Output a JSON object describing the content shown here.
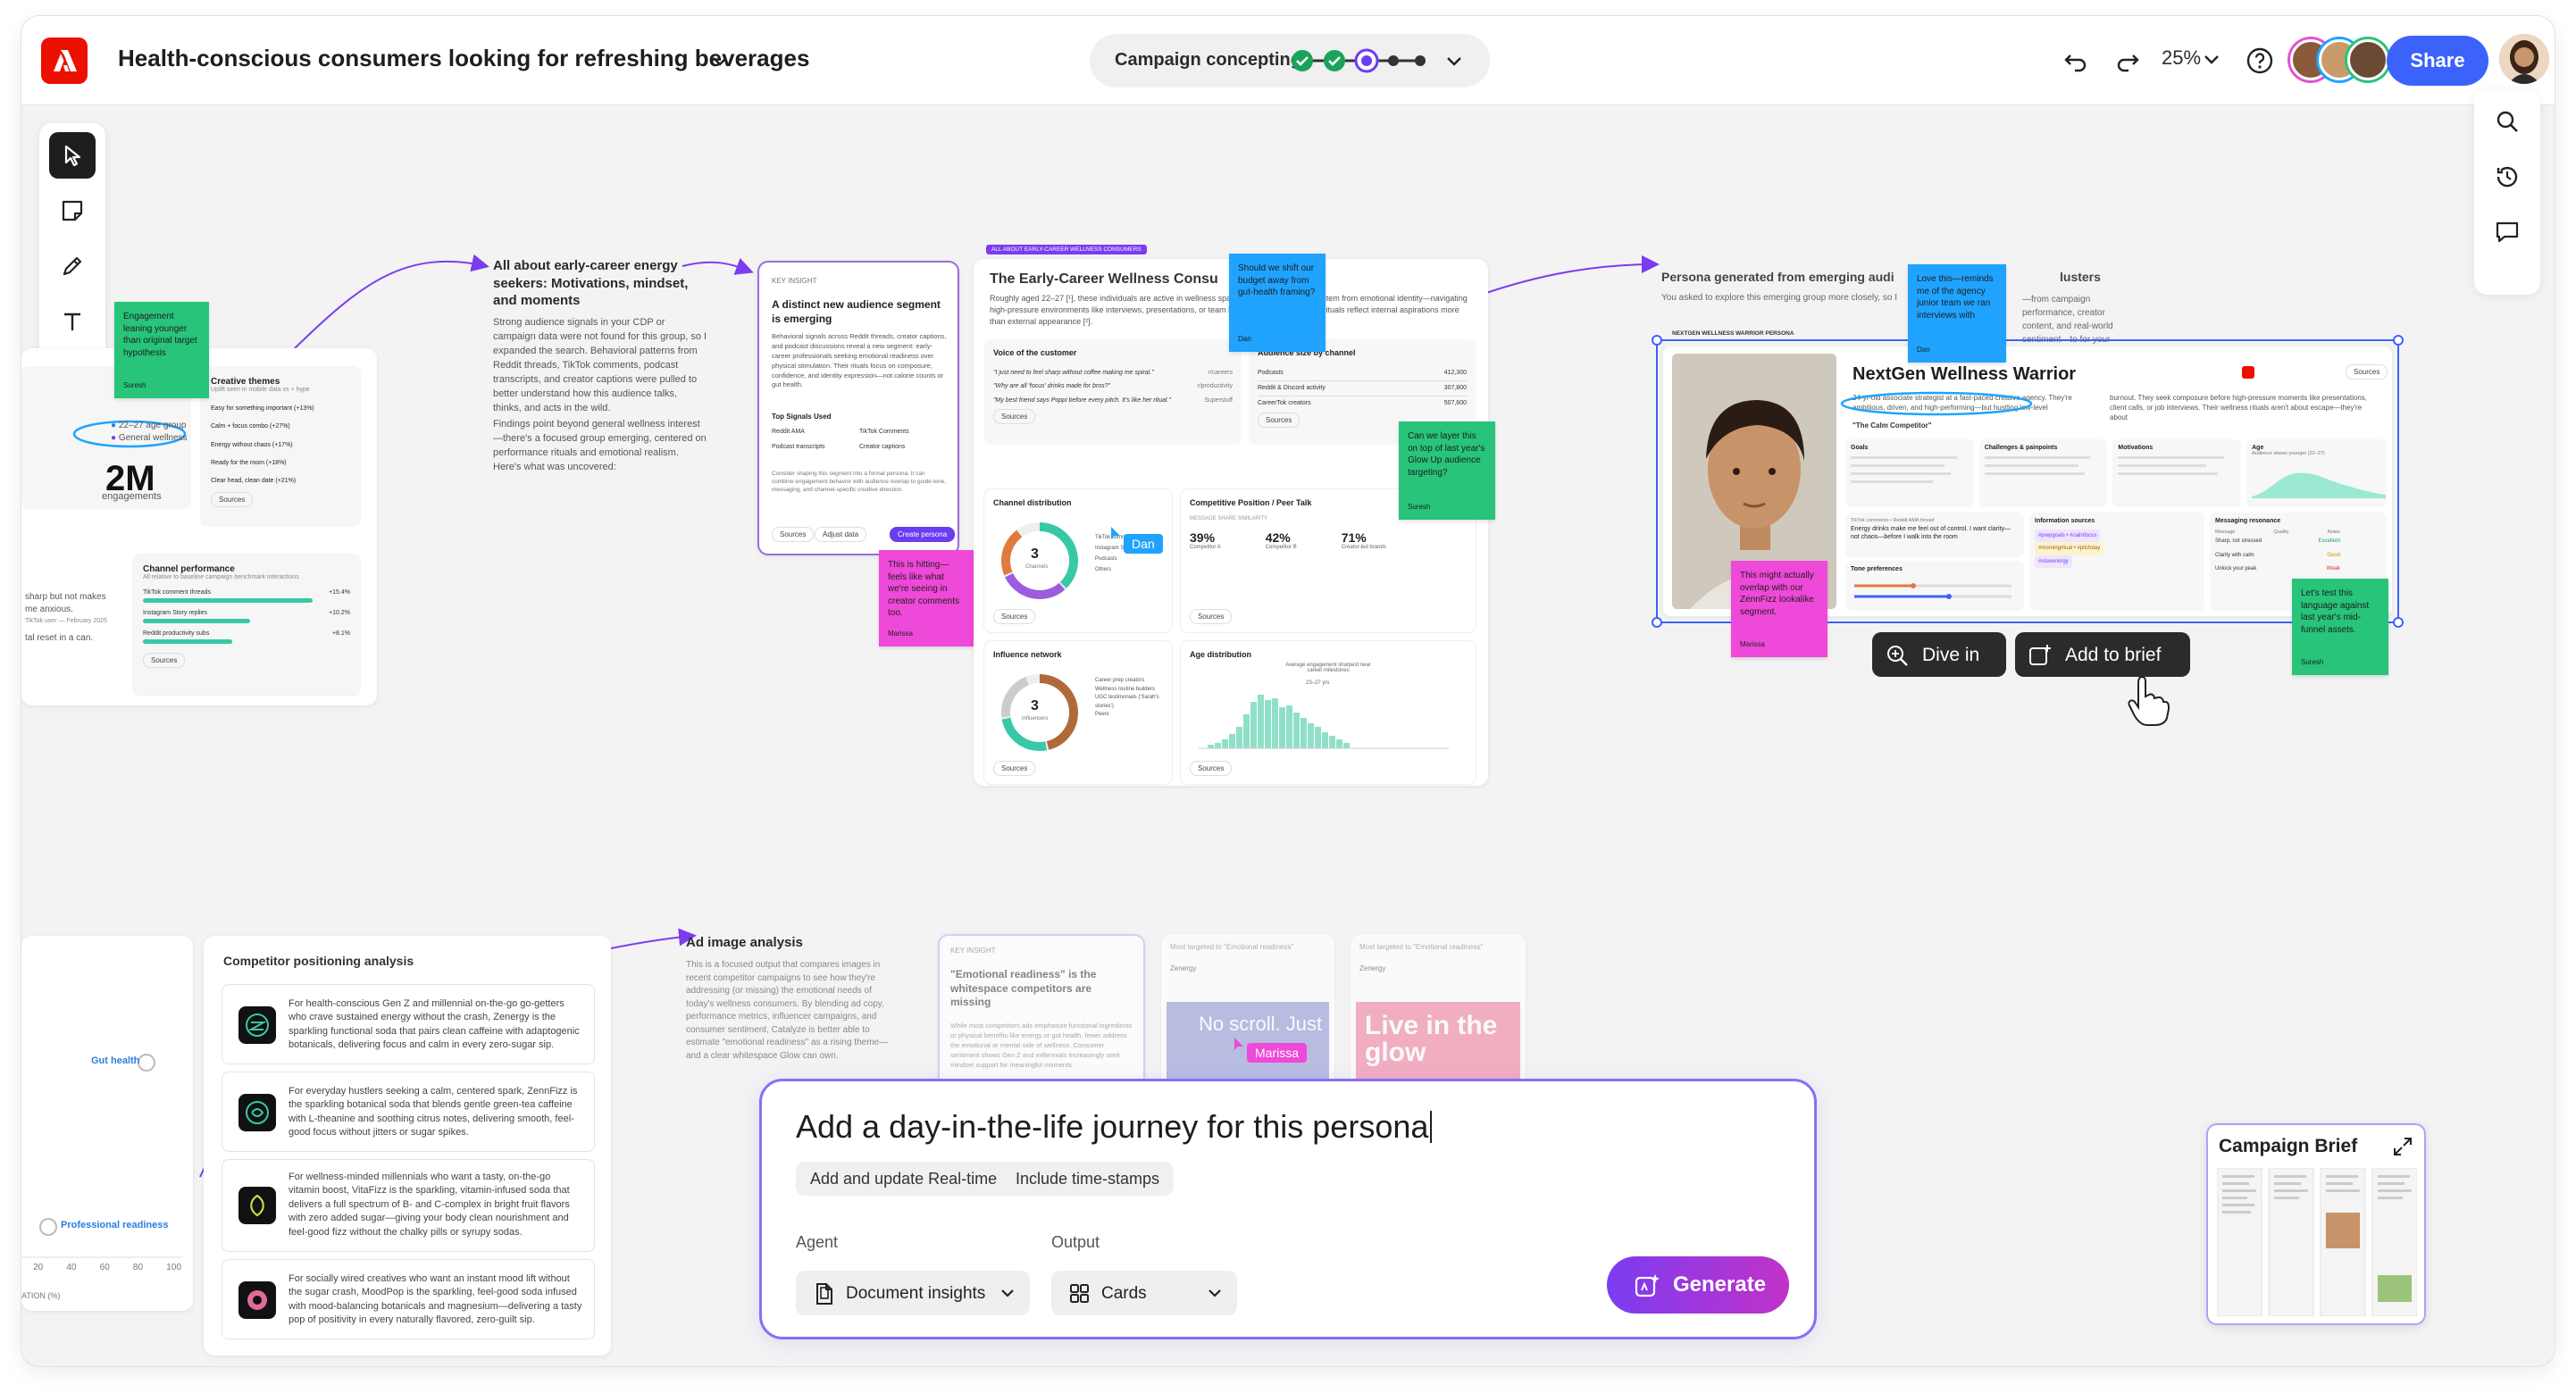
{
  "header": {
    "title": "Health-conscious consumers looking for refreshing beverages",
    "stage_label": "Campaign concepting",
    "zoom": "25%",
    "share_label": "Share"
  },
  "canvas": {
    "left_card": {
      "big_stat": "2M",
      "big_stat_caption": "engagements",
      "creative_themes_title": "Creative themes",
      "creative_themes_sub": "Uplift seen in mobile data vs + hype",
      "themes": [
        "Easy for something important (+13%)",
        "Calm + focus combo (+27%)",
        "Energy without chaos (+17%)",
        "Ready for the room (+18%)",
        "Clear head, clean date (+21%)"
      ],
      "legend": [
        "22–27 age group",
        "General wellness"
      ],
      "sources": "Sources",
      "channel_perf_title": "Channel performance",
      "channel_perf_sub": "All relative to baseline campaign benchmark interactions",
      "channels": [
        "TikTok comment threads",
        "Instagram Story replies",
        "Reddit productivity subs"
      ],
      "channel_vals": [
        "+15.4%",
        "+10.2%",
        "+8.1%"
      ],
      "quote_1": "sharp but not makes me anxious.",
      "quote_author": "TikTok user — February 2025",
      "quote_2": "tal reset in a can.",
      "sticky_engagement": "Engagement leaning younger than original target hypothesis",
      "sticky_engagement_author": "Suresh"
    },
    "all_about": {
      "title": "All about early-career energy seekers: Motivations, mindset, and moments",
      "body": "Strong audience signals in your CDP or campaign data were not found for this group, so I expanded the search. Behavioral patterns from Reddit threads, TikTok comments, podcast transcripts, and creator captions were pulled to better understand how this audience talks, thinks, and acts in the wild.",
      "body2": "Findings point beyond general wellness interest—there's a focused group emerging, centered on performance rituals and emotional realism. Here's what was uncovered:"
    },
    "key_insight": {
      "kicker": "KEY INSIGHT",
      "title": "A distinct new audience segment is emerging",
      "body": "Behavioral signals across Reddit threads, creator captions, and podcast discussions reveal a new segment: early-career professionals seeking emotional readiness over physical stimulation. Their rituals focus on composure, confidence, and identity expression—not calorie counts or gut health.",
      "signals_title": "Top Signals Used",
      "signals": [
        "Reddit AMA",
        "TikTok Comments",
        "Podcast transcripts",
        "Creator captions"
      ],
      "footer_note": "Consider shaping this segment into a formal persona. It can combine engagement behavior with audience overlap to guide tone, messaging, and channel-specific creative direction.",
      "btn_sources": "Sources",
      "btn_adjust": "Adjust data",
      "btn_create": "Create persona"
    },
    "sticky_hitting": {
      "text": "This is hitting—feels like what we're seeing in creator comments too.",
      "author": "Marissa"
    },
    "wellness_consumer": {
      "tag": "ALL ABOUT EARLY-CAREER WELLNESS CONSUMERS",
      "title": "The Early-Career Wellness Consu",
      "body": "Roughly aged 22–27 [¹], these individuals are active in wellness spaces, but their motivations stem from emotional identity—navigating high-pressure environments like interviews, presentations, or team leadership. Their wellness rituals reflect internal aspirations more than external appearance [²].",
      "voice_title": "Voice of the customer",
      "voices": [
        "\"I just need to feel sharp without coffee making me spiral.\"",
        "\"Why are all 'focus' drinks made for bros?\"",
        "\"My best friend says Poppi before every pitch. It's like her ritual.\""
      ],
      "voice_tags": [
        "r/careers",
        "r/productivity",
        "Superstuff"
      ],
      "audience_title": "Audience size by channel",
      "audience_rows": [
        "Podcasts",
        "Reddit & Discord activity",
        "CareerTok creators"
      ],
      "audience_vals": [
        "412,300",
        "307,800",
        "507,600"
      ],
      "channel_dist_title": "Channel distribution",
      "channel_dist_center": "3",
      "channel_dist_caption": "Channels",
      "channel_dist_legend": [
        "TikTok comments",
        "Instagram Stories",
        "Podcasts",
        "Others"
      ],
      "competitive_title": "Competitive Position / Peer Talk",
      "competitive_sub": "MESSAGE SHARE SIMILARITY",
      "competitive_vals": [
        "39%",
        "42%",
        "71%"
      ],
      "competitive_labels": [
        "Competitor A",
        "Competitor B",
        "Creator-led brands"
      ],
      "influence_title": "Influence network",
      "influence_center": "3",
      "influence_caption": "Influencers",
      "influence_legend": [
        "Career prep creators",
        "Wellness routine builders",
        "UGC testimonials ('Sarah's stories')",
        "Peers"
      ],
      "age_title": "Age distribution",
      "age_sub": "Average engagement sharpest near career milestones",
      "age_range": "23–27 yrs",
      "sources": "Sources"
    },
    "sticky_budget": {
      "text": "Should we shift our budget away from gut-health framing?",
      "author": "Dan"
    },
    "sticky_layer": {
      "text": "Can we layer this on top of last year's Glow Up audience targeting?",
      "author": "Suresh"
    },
    "cursor_dan": "Dan",
    "persona": {
      "header": "Persona generated from emerging audi",
      "header_tail": "lusters",
      "body": "You asked to explore this emerging group more closely, so I",
      "body_tail": "—from campaign performance, creator content, and real-world sentiment—to",
      "body_tail2": "for your strategy work.",
      "tag": "NEXTGEN WELLNESS WARRIOR PERSONA",
      "name": "NextGen Wellness Warrior",
      "quote_intro": "24-yr-old associate strategist at a fast-paced creative agency. They're ambitious, driven, and high-performing—but hustling low-level",
      "burnout": "burnout. They seek composure before high-pressure moments like presentations, client calls, or job interviews. Their wellness rituals aren't about escape—they're about",
      "persona_label": "\"The Calm Competitor\"",
      "sources": "Sources",
      "goals_title": "Goals",
      "challenges_title": "Challenges & painpoints",
      "motivations_title": "Motivations",
      "age_title": "Age",
      "age_sub": "Audience skews younger (22–27)",
      "tiktok_title": "TikTok comments • Reddit AMA thread",
      "tiktok_quote": "Energy drinks make me feel out of control. I want clarity—not chaos—before I walk into the room",
      "info_title": "Information sources",
      "msg_title": "Messaging resonance",
      "msg_cols": [
        "Message",
        "Quality",
        "Notes"
      ],
      "tone_title": "Tone preferences",
      "hashtags": [
        "#prepgoals • #calmfocus",
        "#morningritual • #pitchday",
        "#slowenergy"
      ],
      "msg_rows": [
        "Sharp, not stressed",
        "Clarity with calm",
        "Unlock your peak"
      ],
      "msg_notes": [
        "Excellent",
        "Good",
        "Weak"
      ]
    },
    "sticky_love": {
      "text": "Love this—reminds me of the agency junior team we ran interviews with",
      "author": "Dan"
    },
    "sticky_overlap": {
      "text": "This might actually overlap with our ZennFizz lookalike segment.",
      "author": "Marissa"
    },
    "sticky_test": {
      "text": "Let's test this language against last year's mid-funnel assets.",
      "author": "Suresh"
    },
    "dive_in": "Dive in",
    "add_to_brief": "Add to brief",
    "competitor": {
      "title": "Competitor positioning analysis",
      "rows": [
        {
          "brand": "Zenergy",
          "text": "For health-conscious Gen Z and millennial on-the-go go-getters who crave sustained energy without the crash, Zenergy is the sparkling functional soda that pairs clean caffeine with adaptogenic botanicals, delivering focus and calm in every zero-sugar sip."
        },
        {
          "brand": "ZennFizz",
          "text": "For everyday hustlers seeking a calm, centered spark, ZennFizz is the sparkling botanical soda that blends gentle green-tea caffeine with L-theanine and soothing citrus notes, delivering smooth, feel-good focus without jitters or sugar spikes."
        },
        {
          "brand": "VitaFizz",
          "text": "For wellness-minded millennials who want a tasty, on-the-go vitamin boost, VitaFizz is the sparkling, vitamin-infused soda that delivers a full spectrum of B- and C-complex in bright fruit flavors with zero added sugar—giving your body clean nourishment and feel-good fizz without the chalky pills or syrupy sodas."
        },
        {
          "brand": "MoodPop",
          "text": "For socially wired creatives who want an instant mood lift without the sugar crash, MoodPop is the sparkling, feel-good soda infused with mood-balancing botanicals and magnesium—delivering a tasty pop of positivity in every naturally flavored, zero-guilt sip."
        }
      ]
    },
    "map": {
      "gut_health": "Gut health",
      "professional_readiness": "Professional readiness",
      "axis_label": "ATION (%)",
      "ticks": [
        "20",
        "40",
        "60",
        "80",
        "100"
      ]
    },
    "ad_analysis": {
      "title": "Ad image analysis",
      "body": "This is a focused output that compares images in recent competitor campaigns to see how they're addressing (or missing) the emotional needs of today's wellness consumers. By blending ad copy, performance metrics, influencer campaigns, and consumer sentiment, Catalyze is better able to estimate \"emotional readiness\" as a rising theme—and a clear whitespace Glow can own."
    },
    "key_insight_2": {
      "kicker": "KEY INSIGHT",
      "title": "\"Emotional readiness\" is the whitespace competitors are missing",
      "body": "While most competitors ads emphasize functional ingredients or physical benefits like energy or gut health, fewer address the emotional or mental side of wellness. Consumer sentiment shows Gen Z and millennials increasingly seek mindset support for meaningful moments."
    },
    "ads": [
      {
        "tag": "Most targeted to \"Emotional readiness\"",
        "brand": "Zenergy",
        "headline": "No scroll. Just"
      },
      {
        "tag": "Most targeted to \"Emotional readiness\"",
        "brand": "Zenergy",
        "headline": "Live in the glow"
      }
    ],
    "cursor_marissa": "Marissa"
  },
  "prompt": {
    "text": "Add a day-in-the-life journey for this persona",
    "chips": [
      "Add and update Real-time CDP",
      "Include time-stamps"
    ],
    "agent_label": "Agent",
    "agent_value": "Document insights",
    "output_label": "Output",
    "output_value": "Cards",
    "generate_label": "Generate"
  },
  "brief": {
    "title": "Campaign Brief"
  },
  "colors": {
    "accent": "#3b63fb",
    "adobe_red": "#eb1000",
    "purple": "#7b3cf0",
    "teal": "#37c9a7",
    "sticky_green": "#27c47a",
    "sticky_blue": "#1fa3ff",
    "sticky_pink": "#ee49d8"
  }
}
